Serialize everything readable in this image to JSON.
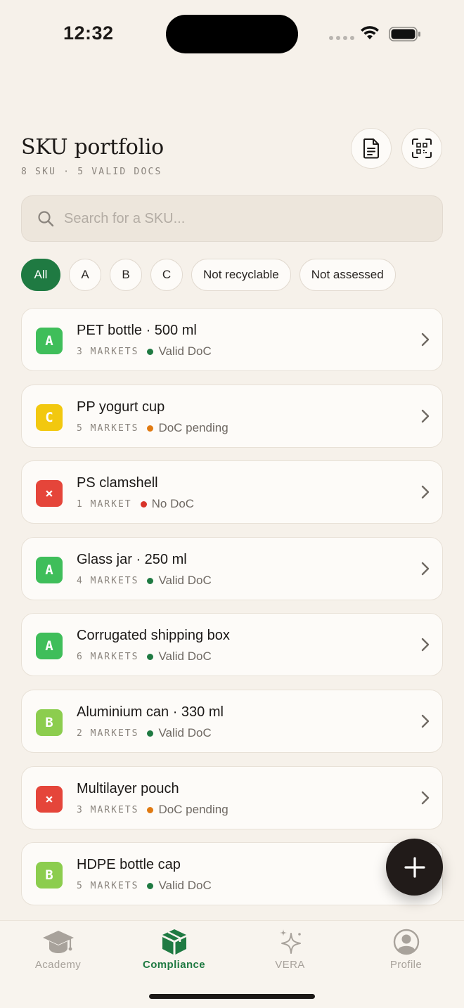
{
  "status_bar": {
    "time": "12:32"
  },
  "header": {
    "title": "SKU portfolio",
    "subtitle": "8 SKU · 5 VALID DOCS",
    "doc_icon": "document-icon",
    "scan_icon": "qr-scan-icon"
  },
  "search": {
    "placeholder": "Search for a SKU..."
  },
  "filters": [
    {
      "label": "All",
      "active": true
    },
    {
      "label": "A",
      "active": false
    },
    {
      "label": "B",
      "active": false
    },
    {
      "label": "C",
      "active": false
    },
    {
      "label": "Not recyclable",
      "active": false
    },
    {
      "label": "Not assessed",
      "active": false
    }
  ],
  "colors": {
    "accent": "#1f7a42",
    "grade_A": "#3fbe5a",
    "grade_B": "#8ccd4e",
    "grade_C": "#f2c80f",
    "grade_X": "#e5453a",
    "status_valid": "#1f7a42",
    "status_pending": "#e07a12",
    "status_none": "#d8342a"
  },
  "skus": [
    {
      "grade": "A",
      "grade_color": "#3fbe5a",
      "name": "PET bottle · 500 ml",
      "markets": "3 MARKETS",
      "status": "Valid DoC",
      "status_color": "#1f7a42"
    },
    {
      "grade": "C",
      "grade_color": "#f2c80f",
      "name": "PP yogurt cup",
      "markets": "5 MARKETS",
      "status": "DoC pending",
      "status_color": "#e07a12"
    },
    {
      "grade": "×",
      "grade_color": "#e5453a",
      "name": "PS clamshell",
      "markets": "1 MARKET",
      "status": "No DoC",
      "status_color": "#d8342a"
    },
    {
      "grade": "A",
      "grade_color": "#3fbe5a",
      "name": "Glass jar · 250 ml",
      "markets": "4 MARKETS",
      "status": "Valid DoC",
      "status_color": "#1f7a42"
    },
    {
      "grade": "A",
      "grade_color": "#3fbe5a",
      "name": "Corrugated shipping box",
      "markets": "6 MARKETS",
      "status": "Valid DoC",
      "status_color": "#1f7a42"
    },
    {
      "grade": "B",
      "grade_color": "#8ccd4e",
      "name": "Aluminium can · 330 ml",
      "markets": "2 MARKETS",
      "status": "Valid DoC",
      "status_color": "#1f7a42"
    },
    {
      "grade": "×",
      "grade_color": "#e5453a",
      "name": "Multilayer pouch",
      "markets": "3 MARKETS",
      "status": "DoC pending",
      "status_color": "#e07a12"
    },
    {
      "grade": "B",
      "grade_color": "#8ccd4e",
      "name": "HDPE bottle cap",
      "markets": "5 MARKETS",
      "status": "Valid DoC",
      "status_color": "#1f7a42"
    }
  ],
  "fab": {
    "icon": "plus-icon"
  },
  "tabs": [
    {
      "label": "Academy",
      "icon": "graduation-cap-icon",
      "active": false
    },
    {
      "label": "Compliance",
      "icon": "package-icon",
      "active": true
    },
    {
      "label": "VERA",
      "icon": "sparkles-icon",
      "active": false
    },
    {
      "label": "Profile",
      "icon": "user-icon",
      "active": false
    }
  ]
}
